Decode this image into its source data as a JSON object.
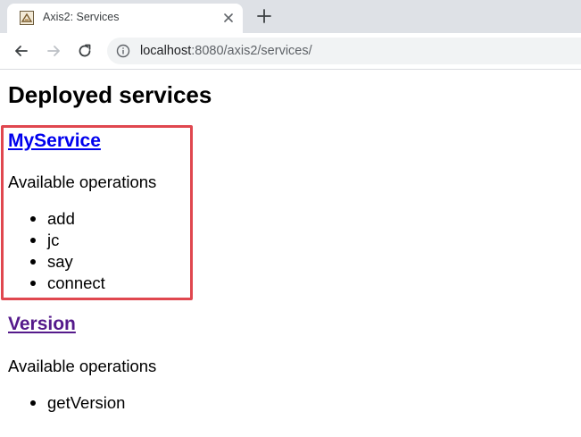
{
  "browser": {
    "tab": {
      "title": "Axis2: Services"
    },
    "address": {
      "host": "localhost",
      "rest": ":8080/axis2/services/"
    },
    "icons": {
      "favicon": "axis2-favicon-icon",
      "close": "close-icon",
      "new_tab": "plus-icon",
      "back": "arrow-left-icon",
      "forward": "arrow-right-icon",
      "reload": "reload-icon",
      "site_info": "info-icon"
    }
  },
  "page": {
    "heading": "Deployed services",
    "ops_label": "Available operations",
    "highlight_color": "#e0474f",
    "services": [
      {
        "name": "MyService",
        "visited": false,
        "operations": [
          "add",
          "jc",
          "say",
          "connect"
        ]
      },
      {
        "name": "Version",
        "visited": true,
        "operations": [
          "getVersion"
        ]
      }
    ]
  }
}
